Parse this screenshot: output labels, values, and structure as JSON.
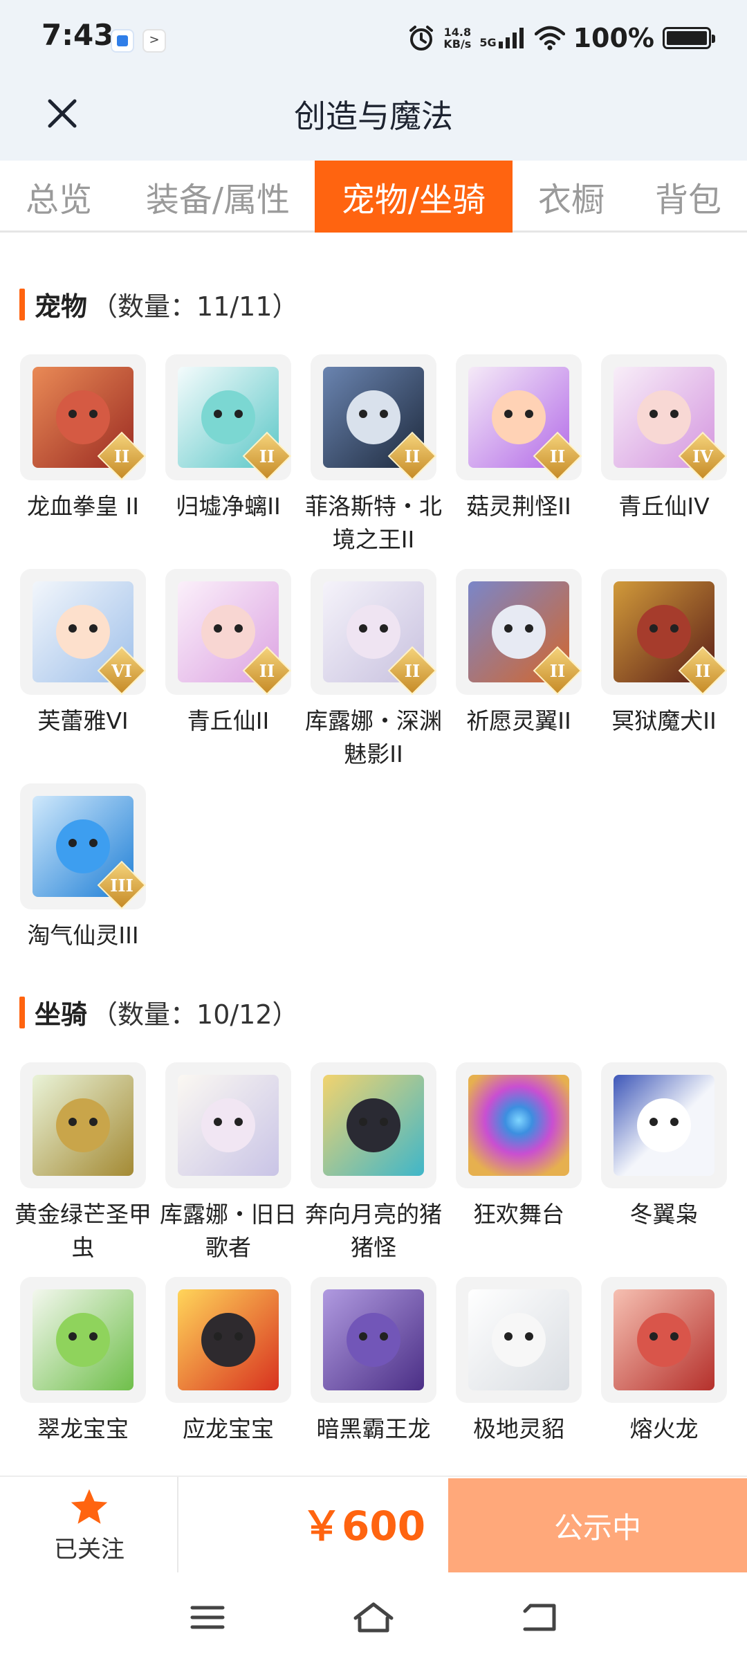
{
  "status_bar": {
    "time": "7:43",
    "app_icons": [
      "calendar-app-icon",
      "terminal-app-icon"
    ],
    "net_speed_value": "14.8",
    "net_speed_unit": "KB/s",
    "network": "5G",
    "battery": "100%"
  },
  "header": {
    "title": "创造与魔法"
  },
  "tabs": [
    {
      "label": "总览",
      "active": false
    },
    {
      "label": "装备/属性",
      "active": false
    },
    {
      "label": "宠物/坐骑",
      "active": true
    },
    {
      "label": "衣橱",
      "active": false
    },
    {
      "label": "背包",
      "active": false
    }
  ],
  "pets": {
    "name": "宠物",
    "count": "（数量：11/11）",
    "items": [
      {
        "label": "龙血拳皇 II",
        "tier": "II",
        "color": "#c9473b"
      },
      {
        "label": "归墟净螭II",
        "tier": "II",
        "color": "#4fc6c4"
      },
      {
        "label": "菲洛斯特・北境之王II",
        "tier": "II",
        "color": "#3a4f6e"
      },
      {
        "label": "菇灵荆怪II",
        "tier": "II",
        "color": "#a45ce6"
      },
      {
        "label": "青丘仙IV",
        "tier": "IV",
        "color": "#e6b6e8"
      },
      {
        "label": "芙蕾雅VI",
        "tier": "VI",
        "color": "#c9dcf5"
      },
      {
        "label": "青丘仙II",
        "tier": "II",
        "color": "#eab8e6"
      },
      {
        "label": "库露娜・深渊魅影II",
        "tier": "II",
        "color": "#d9d4ea"
      },
      {
        "label": "祈愿灵翼II",
        "tier": "II",
        "color": "#d4662b"
      },
      {
        "label": "冥狱魔犬II",
        "tier": "II",
        "color": "#7a2c23"
      },
      {
        "label": "淘气仙灵III",
        "tier": "III",
        "color": "#2e8fe0"
      }
    ]
  },
  "mounts": {
    "name": "坐骑",
    "count": "（数量：10/12）",
    "items": [
      {
        "label": "黄金绿芒圣甲虫",
        "color": "#b69a3d"
      },
      {
        "label": "库露娜・旧日歌者",
        "color": "#e3e0f2"
      },
      {
        "label": "奔向月亮的猪猪怪",
        "color": "#1f1f28"
      },
      {
        "label": "狂欢舞台",
        "color": "#c95ad6"
      },
      {
        "label": "冬翼枭",
        "color": "#e9eef6"
      },
      {
        "label": "翠龙宝宝",
        "color": "#7fc84a"
      },
      {
        "label": "应龙宝宝",
        "color": "#e8462a"
      },
      {
        "label": "暗黑霸王龙",
        "color": "#6a4ca8"
      },
      {
        "label": "极地灵貂",
        "color": "#eef0f2"
      },
      {
        "label": "熔火龙",
        "color": "#d2473f"
      }
    ]
  },
  "bottom": {
    "follow_label": "已关注",
    "price": "￥600",
    "status_label": "公示中"
  },
  "colors": {
    "accent": "#ff6410",
    "status_button": "#ffa87a"
  }
}
